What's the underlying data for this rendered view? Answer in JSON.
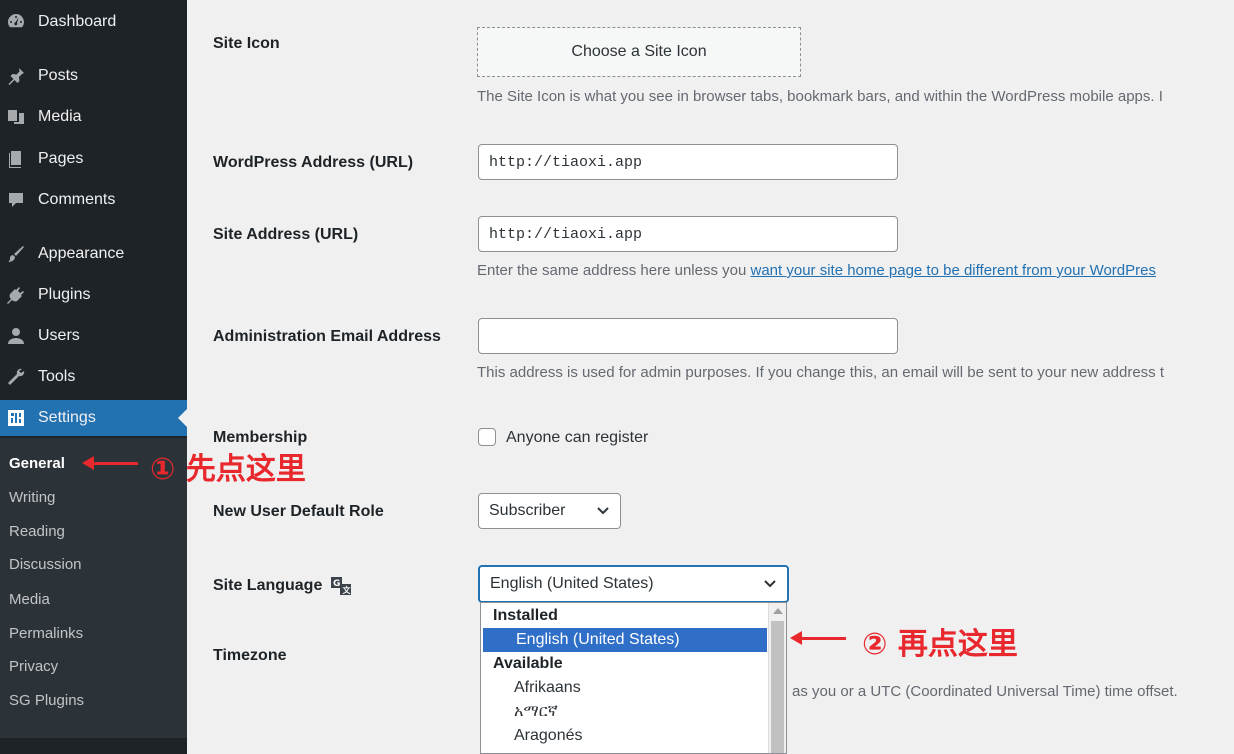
{
  "sidebar": {
    "items": [
      {
        "label": "Dashboard",
        "icon": "dashboard-icon"
      },
      {
        "label": "Posts",
        "icon": "pin-icon"
      },
      {
        "label": "Media",
        "icon": "media-icon"
      },
      {
        "label": "Pages",
        "icon": "pages-icon"
      },
      {
        "label": "Comments",
        "icon": "comment-icon"
      },
      {
        "label": "Appearance",
        "icon": "paintbrush-icon"
      },
      {
        "label": "Plugins",
        "icon": "plug-icon"
      },
      {
        "label": "Users",
        "icon": "user-icon"
      },
      {
        "label": "Tools",
        "icon": "wrench-icon"
      },
      {
        "label": "Settings",
        "icon": "settings-icon"
      }
    ],
    "submenu": [
      "General",
      "Writing",
      "Reading",
      "Discussion",
      "Media",
      "Permalinks",
      "Privacy",
      "SG Plugins"
    ]
  },
  "form": {
    "site_icon": {
      "label": "Site Icon",
      "button": "Choose a Site Icon",
      "desc": "The Site Icon is what you see in browser tabs, bookmark bars, and within the WordPress mobile apps. I"
    },
    "wp_address": {
      "label": "WordPress Address (URL)",
      "value": "http://tiaoxi.app"
    },
    "site_address": {
      "label": "Site Address (URL)",
      "value": "http://tiaoxi.app",
      "desc_prefix": "Enter the same address here unless you ",
      "desc_link": "want your site home page to be different from your WordPres"
    },
    "admin_email": {
      "label": "Administration Email Address",
      "value": "",
      "desc": "This address is used for admin purposes. If you change this, an email will be sent to your new address t"
    },
    "membership": {
      "label": "Membership",
      "checkbox_label": "Anyone can register"
    },
    "default_role": {
      "label": "New User Default Role",
      "value": "Subscriber"
    },
    "site_language": {
      "label": "Site Language",
      "value": "English (United States)"
    },
    "timezone": {
      "label": "Timezone",
      "desc": "as you or a UTC (Coordinated Universal Time) time offset."
    }
  },
  "language_dropdown": {
    "group_installed": "Installed",
    "installed": [
      "English (United States)"
    ],
    "group_available": "Available",
    "available": [
      "Afrikaans",
      "አማርኛ",
      "Aragonés"
    ]
  },
  "annotations": {
    "step1": "① 先点这里",
    "step2": "② 再点这里",
    "color": "#e8282d"
  }
}
